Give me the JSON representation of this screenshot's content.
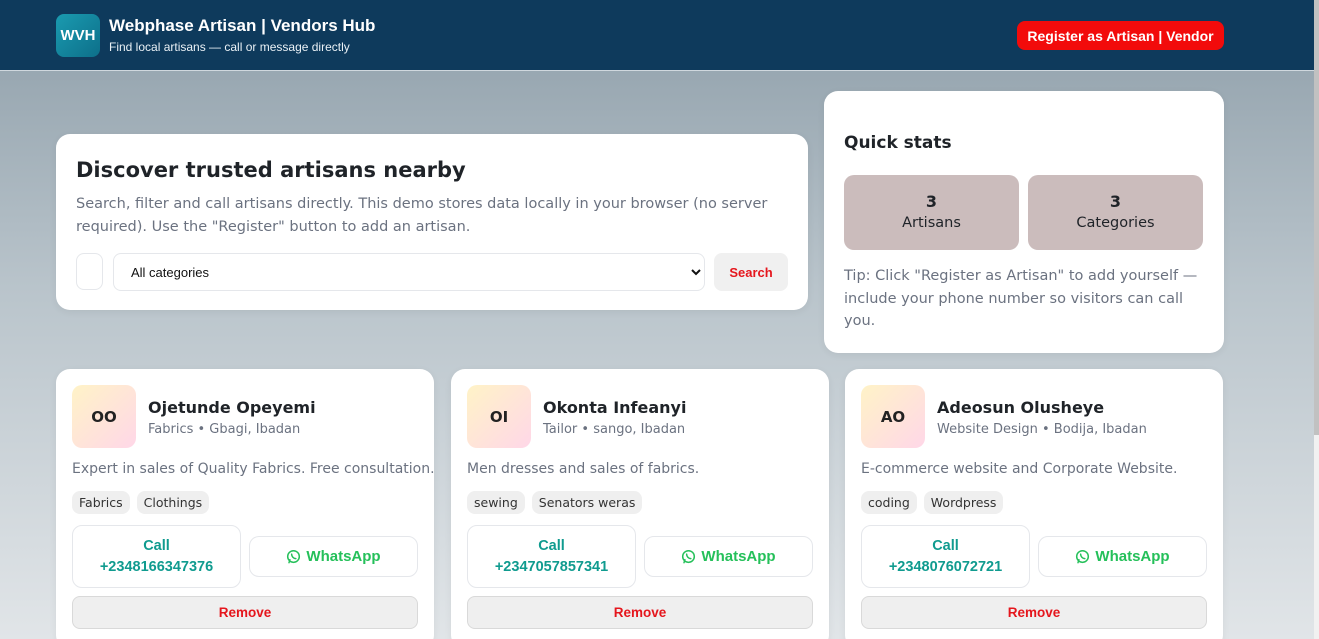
{
  "header": {
    "logo_text": "WVH",
    "title": "Webphase Artisan | Vendors Hub",
    "subtitle": "Find local artisans — call or message directly",
    "register_label": "Register as Artisan | Vendor",
    "background_color": "#0e3a5c",
    "accent_color": "#f20b0b"
  },
  "discover": {
    "heading": "Discover trusted artisans nearby",
    "description": "Search, filter and call artisans directly. This demo stores data locally in your browser (no server required). Use the \"Register\" button to add an artisan.",
    "category_selected": "All categories",
    "search_label": "Search"
  },
  "stats": {
    "heading": "Quick stats",
    "artisans_count": "3",
    "artisans_label": "Artisans",
    "categories_count": "3",
    "categories_label": "Categories",
    "tip": "Tip: Click \"Register as Artisan\" to add yourself — include your phone number so visitors can call you."
  },
  "cards": [
    {
      "initials": "OO",
      "name": "Ojetunde Opeyemi",
      "meta": "Fabrics • Gbagi, Ibadan",
      "description": "Expert in sales of Quality Fabrics. Free consultation.",
      "tags": [
        "Fabrics",
        "Clothings"
      ],
      "call_label": "Call",
      "phone": "+2348166347376",
      "whatsapp_label": "WhatsApp",
      "remove_label": "Remove"
    },
    {
      "initials": "OI",
      "name": "Okonta Infeanyi",
      "meta": "Tailor • sango, Ibadan",
      "description": "Men dresses and sales of fabrics.",
      "tags": [
        "sewing",
        "Senators weras"
      ],
      "call_label": "Call",
      "phone": "+2347057857341",
      "whatsapp_label": "WhatsApp",
      "remove_label": "Remove"
    },
    {
      "initials": "AO",
      "name": "Adeosun Olusheye",
      "meta": "Website Design • Bodija, Ibadan",
      "description": "E-commerce website and Corporate Website.",
      "tags": [
        "coding",
        "Wordpress"
      ],
      "call_label": "Call",
      "phone": "+2348076072721",
      "whatsapp_label": "WhatsApp",
      "remove_label": "Remove"
    }
  ],
  "icons": {
    "whatsapp": "whatsapp-icon"
  },
  "colors": {
    "call": "#109b8f",
    "whatsapp": "#25c05a",
    "remove": "#e5161d",
    "stat_box": "#cbbcbc"
  }
}
